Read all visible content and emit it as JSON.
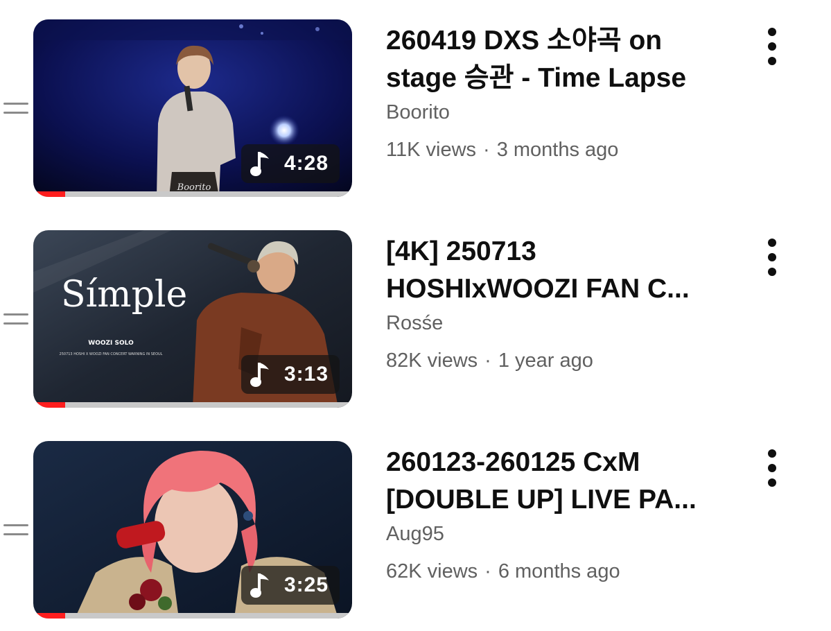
{
  "playlist": {
    "items": [
      {
        "title": "260419 DXS 소야곡 on stage 승관 - Time Lapse",
        "channel": "Boorito",
        "views": "11K views",
        "age": "3 months ago",
        "duration": "4:28",
        "watch_progress": 0.1,
        "thumbnail_caption": "Boorito",
        "thumbnail_icon": "music-note-icon"
      },
      {
        "title": "[4K] 250713 HOSHIxWOOZI FAN CONCERT WARNING IN SEOUL",
        "title_display": "[4K] 250713 HOSHIxWOOZI FAN C...",
        "channel": "Rosśe",
        "views": "82K views",
        "age": "1 year ago",
        "duration": "3:13",
        "watch_progress": 0.1,
        "thumbnail_caption": "Símple",
        "thumbnail_subcaption": "WOOZI SOLO",
        "thumbnail_small_text": "250713 HOSHI X WOOZI FAN CONCERT WARNING IN SEOUL",
        "thumbnail_icon": "music-note-icon"
      },
      {
        "title": "260123-260125 CxM [DOUBLE UP] LIVE PA...",
        "channel": "Aug95",
        "views": "62K views",
        "age": "6 months ago",
        "duration": "3:25",
        "watch_progress": 0.1,
        "thumbnail_icon": "music-note-icon"
      }
    ],
    "meta_separator": "·"
  },
  "colors": {
    "progress": "#ff1e1e",
    "title": "#0f0f0f",
    "secondary": "#606060"
  }
}
